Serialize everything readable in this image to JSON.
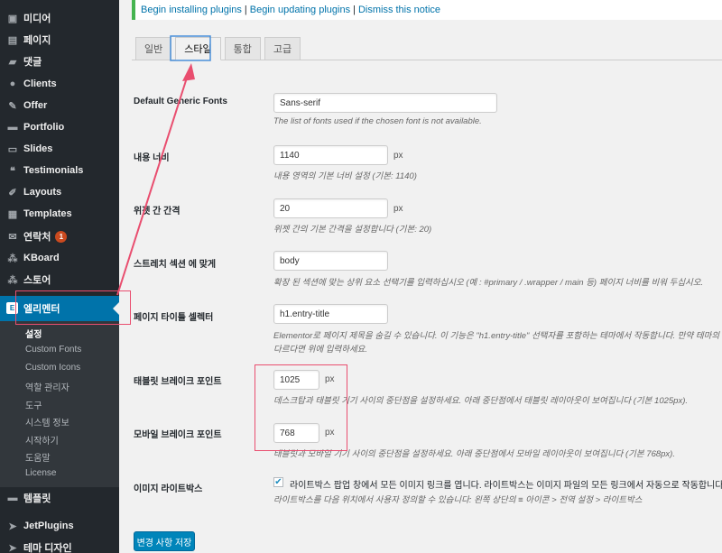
{
  "notice": {
    "link1": "Begin installing plugins",
    "link2": "Begin updating plugins",
    "link3": "Dismiss this notice",
    "separator": "|"
  },
  "sidebar": {
    "items": [
      {
        "label": "미디어",
        "icon": "media-icon"
      },
      {
        "label": "페이지",
        "icon": "page-icon"
      },
      {
        "label": "댓글",
        "icon": "comment-icon"
      },
      {
        "label": "Clients",
        "icon": "clients-icon"
      },
      {
        "label": "Offer",
        "icon": "offer-icon"
      },
      {
        "label": "Portfolio",
        "icon": "portfolio-icon"
      },
      {
        "label": "Slides",
        "icon": "slides-icon"
      },
      {
        "label": "Testimonials",
        "icon": "quote-icon"
      },
      {
        "label": "Layouts",
        "icon": "brush-icon"
      },
      {
        "label": "Templates",
        "icon": "templates-icon"
      },
      {
        "label": "연락처",
        "icon": "mail-icon",
        "badge": "1"
      },
      {
        "label": "KBoard",
        "icon": "kboard-icon"
      },
      {
        "label": "스토어",
        "icon": "store-icon"
      }
    ],
    "current": "엘리멘터",
    "submenu": [
      "설정",
      "Custom Fonts",
      "Custom Icons",
      "역할 관리자",
      "도구",
      "시스템 정보",
      "시작하기",
      "도움말",
      "License"
    ],
    "after": [
      {
        "label": "템플릿",
        "icon": "folder-icon"
      },
      {
        "label": "JetPlugins",
        "icon": "jetplugins-icon"
      },
      {
        "label": "테마 디자인",
        "icon": "theme-design-icon"
      }
    ]
  },
  "tabs": [
    "일반",
    "스타일",
    "통합",
    "고급"
  ],
  "form": {
    "font": {
      "label": "Default Generic Fonts",
      "value": "Sans-serif",
      "desc": "The list of fonts used if the chosen font is not available."
    },
    "width": {
      "label": "내용 너비",
      "value": "1140",
      "unit": "px",
      "desc": "내용 영역의 기본 너비 설정 (기본: 1140)"
    },
    "gap": {
      "label": "위젯 간 간격",
      "value": "20",
      "unit": "px",
      "desc": "위젯 간의 기본 간격을 설정합니다 (기본: 20)"
    },
    "stretch": {
      "label": "스트레치 섹션 에 맞게",
      "value": "body",
      "desc": "확장 된 섹션에 맞는 상위 요소 선택기를 입력하십시오 (예 : #primary / .wrapper / main 등) 페이지 너비를 비워 두십시오."
    },
    "title": {
      "label": "페이지 타이틀 셀렉터",
      "value": "h1.entry-title",
      "desc1": "Elementor로 페이지 제목을 숨길 수 있습니다. 이 기능은 \"h1.entry-title\" 선택자를 포함하는 테마에서 작동합니다. 만약 테마의",
      "desc2": "다르다면 위에 입력하세요."
    },
    "tablet": {
      "label": "태블릿 브레이크 포인트",
      "value": "1025",
      "unit": "px",
      "desc": "데스크탑과 태블릿 기기 사이의 중단점을 설정하세요. 아래 중단점에서 태블릿 레이아웃이 보여집니다 (기본 1025px)."
    },
    "mobile": {
      "label": "모바일 브레이크 포인트",
      "value": "768",
      "unit": "px",
      "desc": "태블릿과 모바일 기기 사이의 중단점을 설정하세요. 아래 중단점에서 모바일 레이아웃이 보여집니다 (기본 768px)."
    },
    "lightbox": {
      "label": "이미지 라이트박스",
      "checked": true,
      "check_label": "라이트박스 팝업 창에서 모든 이미지 링크를 엽니다. 라이트박스는 이미지 파일의 모든 링크에서 자동으로 작동합니다.",
      "desc": "라이트박스를 다음 위치에서 사용자 정의할 수 있습니다: 왼쪽 상단의 ≡ 아이콘 > 전역 설정 > 라이트박스"
    }
  },
  "save_label": "변경 사항 저장",
  "colors": {
    "accent": "#0073aa",
    "annotation": "#e94e6f",
    "sidebar": "#23282d"
  }
}
